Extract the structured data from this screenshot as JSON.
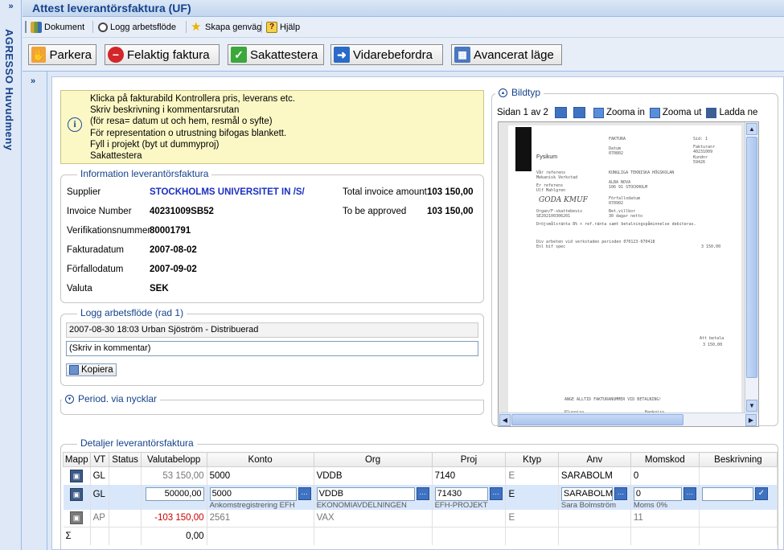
{
  "sidebar": {
    "expand_glyph": "»",
    "label": "AGRESSO Huvudmeny"
  },
  "window": {
    "expand_glyph": "»",
    "title": "Attest leverantörsfaktura (UF)"
  },
  "toolbar": {
    "items": [
      {
        "label": "Dokument",
        "icon": "documents-icon"
      },
      {
        "label": "Logg arbetsflöde",
        "icon": "search-icon"
      },
      {
        "label": "Skapa genväg",
        "icon": "star-icon"
      },
      {
        "label": "Hjälp",
        "icon": "help-icon"
      }
    ]
  },
  "actions": {
    "parkera": "Parkera",
    "felaktig": "Felaktig faktura",
    "sakattestera": "Sakattestera",
    "vidarebefordra": "Vidarebefordra",
    "avancerat": "Avancerat läge"
  },
  "panel": {
    "expand_glyph": "»"
  },
  "info_box": {
    "lines": [
      "Klicka på fakturabild Kontrollera pris, leverans etc.",
      "Skriv beskrivning i kommentarsrutan",
      "(för resa= datum ut och hem, resmål o syfte)",
      "För representation o utrustning bifogas blankett.",
      "Fyll i projekt (byt ut dummyproj)",
      "Sakattestera"
    ]
  },
  "invoice_info": {
    "legend": "Information leverantörsfaktura",
    "supplier_label": "Supplier",
    "supplier_value": "STOCKHOLMS UNIVERSITET IN /S/",
    "invoice_number_label": "Invoice Number",
    "invoice_number_value": "40231009SB52",
    "verif_label": "Verifikationsnummer",
    "verif_value": "80001791",
    "fakturadatum_label": "Fakturadatum",
    "fakturadatum_value": "2007-08-02",
    "forfallodatum_label": "Förfallodatum",
    "forfallodatum_value": "2007-09-02",
    "valuta_label": "Valuta",
    "valuta_value": "SEK",
    "total_label": "Total invoice amount",
    "total_value": "103 150,00",
    "approve_label": "To be approved",
    "approve_value": "103 150,00"
  },
  "workflow_log": {
    "legend": "Logg arbetsflöde (rad 1)",
    "entry": "2007-08-30 18:03 Urban Sjöström - Distribuerad",
    "comment_value": "(Skriv in kommentar)",
    "copy_button": "Kopiera"
  },
  "period": {
    "legend": "Period. via nycklar"
  },
  "image_view": {
    "legend": "Bildtyp",
    "page_info": "Sidan 1 av 2",
    "zoom_in": "Zooma in",
    "zoom_out": "Zooma ut",
    "download": "Ladda ne"
  },
  "details": {
    "legend": "Detaljer leverantörsfaktura",
    "columns": [
      "Mapp",
      "VT",
      "Status",
      "Valutabelopp",
      "Konto",
      "Org",
      "Proj",
      "Ktyp",
      "Anv",
      "Momskod",
      "Beskrivning"
    ],
    "rows": [
      {
        "vt": "GL",
        "status": "",
        "amount": "53 150,00",
        "konto": "5000",
        "org": "VDDB",
        "proj": "7140",
        "ktyp": "E",
        "anv": "SARABOLM",
        "momskod": "0",
        "beskrivning": ""
      },
      {
        "vt": "GL",
        "status": "",
        "amount": "50000,00",
        "konto": "5000",
        "konto_desc": "Ankomstregistrering EFH",
        "org": "VDDB",
        "org_desc": "EKONOMIAVDELNINGEN",
        "proj": "71430",
        "proj_desc": "EFH-PROJEKT",
        "ktyp": "E",
        "anv": "SARABOLM",
        "anv_desc": "Sara Bolmström",
        "momskod": "0",
        "momskod_desc": "Moms 0%",
        "beskrivning": ""
      },
      {
        "vt": "AP",
        "status": "",
        "amount": "-103 150,00",
        "konto": "2561",
        "org": "VAX",
        "proj": "",
        "ktyp": "E",
        "anv": "",
        "momskod": "11",
        "beskrivning": ""
      }
    ],
    "sum_symbol": "Σ",
    "sum_value": "0,00"
  }
}
